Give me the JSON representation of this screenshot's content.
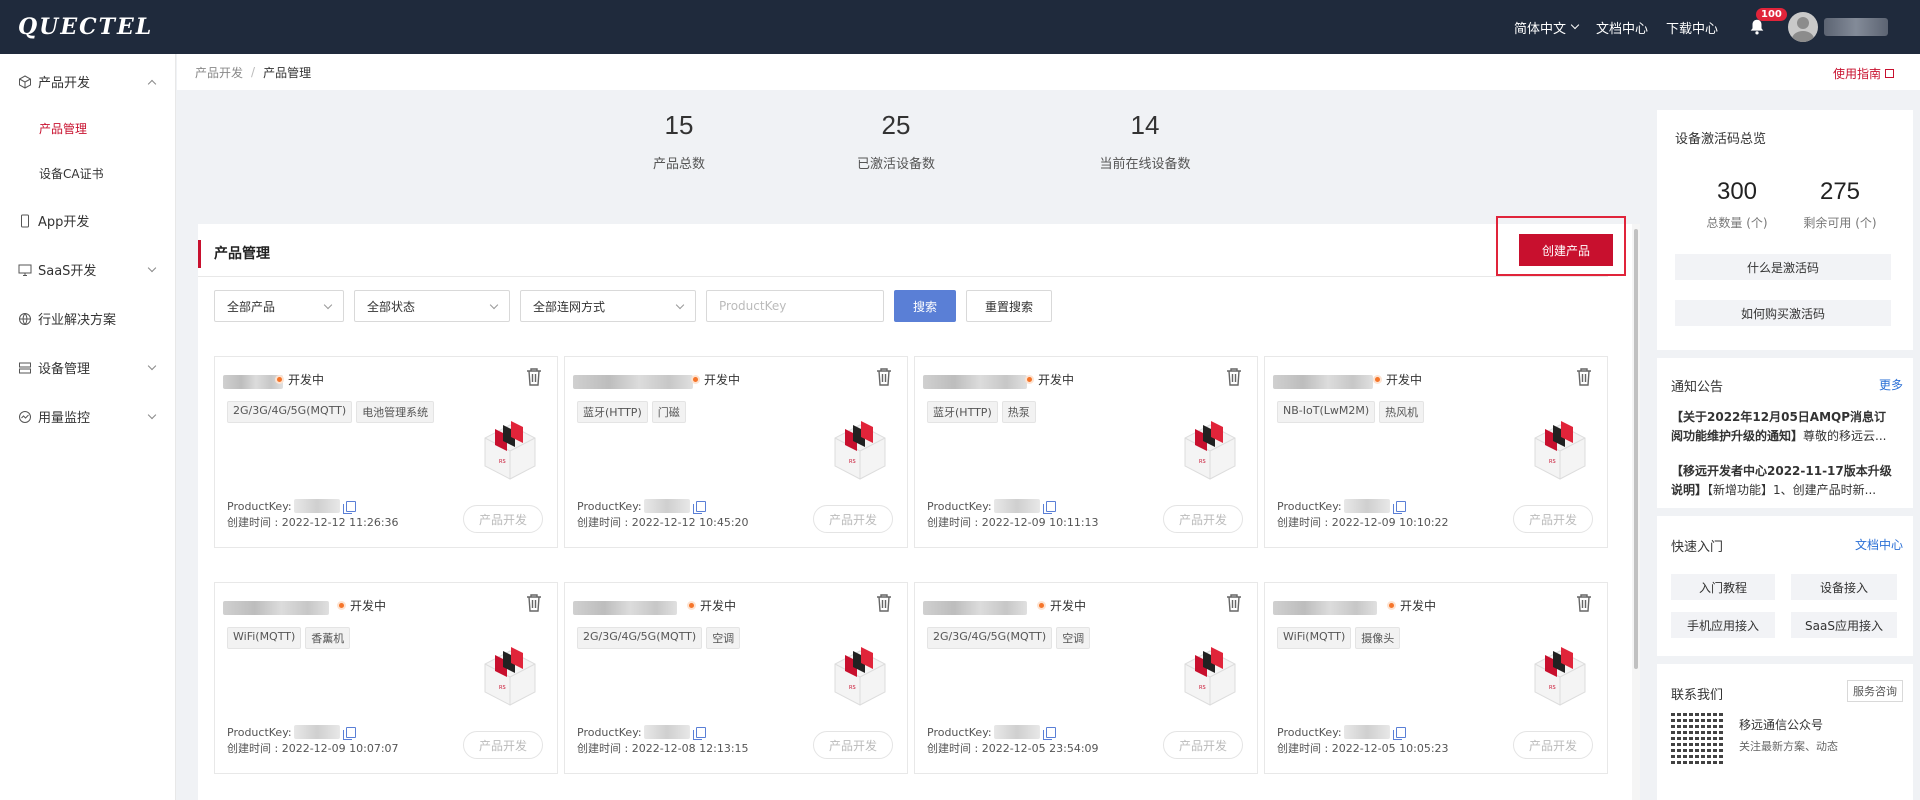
{
  "topbar": {
    "logo": "QUECTEL",
    "lang": "简体中文",
    "docs": "文档中心",
    "downloads": "下载中心",
    "notif_count": "100"
  },
  "sidebar": {
    "items": [
      {
        "label": "产品开发",
        "icon": "cube-icon"
      },
      {
        "label": "产品管理"
      },
      {
        "label": "设备CA证书"
      },
      {
        "label": "App开发",
        "icon": "phone-icon"
      },
      {
        "label": "SaaS开发",
        "icon": "monitor-icon"
      },
      {
        "label": "行业解决方案",
        "icon": "globe-icon"
      },
      {
        "label": "设备管理",
        "icon": "server-icon"
      },
      {
        "label": "用量监控",
        "icon": "gauge-icon"
      }
    ]
  },
  "breadcrumb": {
    "parent": "产品开发",
    "current": "产品管理",
    "sep": "/"
  },
  "guide_link": "使用指南",
  "stats": [
    {
      "value": "15",
      "label": "产品总数"
    },
    {
      "value": "25",
      "label": "已激活设备数"
    },
    {
      "value": "14",
      "label": "当前在线设备数"
    }
  ],
  "panel": {
    "title": "产品管理",
    "create_btn": "创建产品"
  },
  "filters": {
    "product": "全部产品",
    "status": "全部状态",
    "network": "全部连网方式",
    "productkey_placeholder": "ProductKey",
    "search_btn": "搜索",
    "reset_btn": "重置搜索"
  },
  "card_common": {
    "status": "开发中",
    "pk_label": "ProductKey:",
    "dev_btn": "产品开发"
  },
  "cards": [
    {
      "tags": [
        "2G/3G/4G/5G(MQTT)",
        "电池管理系统"
      ],
      "created": "创建时间 : 2022-12-12 11:26:36"
    },
    {
      "tags": [
        "蓝牙(HTTP)",
        "门磁"
      ],
      "created": "创建时间 : 2022-12-12 10:45:20"
    },
    {
      "tags": [
        "蓝牙(HTTP)",
        "热泵"
      ],
      "created": "创建时间 : 2022-12-09 10:11:13"
    },
    {
      "tags": [
        "NB-IoT(LwM2M)",
        "热风机"
      ],
      "created": "创建时间 : 2022-12-09 10:10:22"
    },
    {
      "tags": [
        "WiFi(MQTT)",
        "香薰机"
      ],
      "created": "创建时间 : 2022-12-09 10:07:07"
    },
    {
      "tags": [
        "2G/3G/4G/5G(MQTT)",
        "空调"
      ],
      "created": "创建时间 : 2022-12-08 12:13:15"
    },
    {
      "tags": [
        "2G/3G/4G/5G(MQTT)",
        "空调"
      ],
      "created": "创建时间 : 2022-12-05 23:54:09"
    },
    {
      "tags": [
        "WiFi(MQTT)",
        "摄像头"
      ],
      "created": "创建时间 : 2022-12-05 10:05:23"
    }
  ],
  "activation": {
    "title": "设备激活码总览",
    "total_value": "300",
    "total_label": "总数量 (个)",
    "remain_value": "275",
    "remain_label": "剩余可用 (个)",
    "what_btn": "什么是激活码",
    "buy_btn": "如何购买激活码"
  },
  "notices": {
    "title": "通知公告",
    "more": "更多",
    "items": [
      {
        "bold": "【关于2022年12月05日AMQP消息订阅功能维护升级的通知】",
        "text": "尊敬的移远云..."
      },
      {
        "bold": "【移远开发者中心2022-11-17版本升级说明】",
        "text": "【新增功能】1、创建产品时新..."
      }
    ]
  },
  "quickstart": {
    "title": "快速入门",
    "link": "文档中心",
    "buttons": [
      "入门教程",
      "设备接入",
      "手机应用接入",
      "SaaS应用接入"
    ]
  },
  "contact": {
    "title": "联系我们",
    "service_btn": "服务咨询",
    "account": "移远通信公众号",
    "desc": "关注最新方案、动态"
  }
}
